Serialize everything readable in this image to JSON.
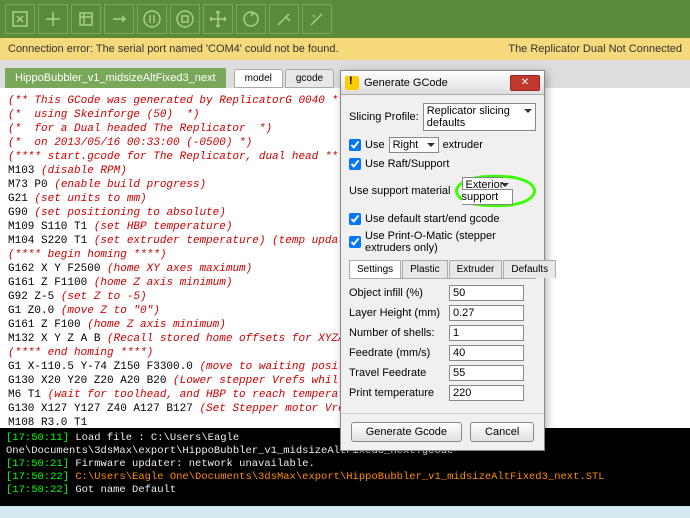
{
  "error": {
    "msg": "Connection error: The serial port named 'COM4' could not be found.",
    "right": "The Replicator Dual Not Connected"
  },
  "file": "HippoBubbler_v1_midsizeAltFixed3_next",
  "tabs": {
    "model": "model",
    "gcode": "gcode"
  },
  "code": {
    "l1": "(** This GCode was generated by ReplicatorG 0040 **",
    "l2": "(*  using Skeinforge (50)  *)",
    "l3": "(*  for a Dual headed The Replicator  *)",
    "l4": "(*  on 2013/05/16 00:33:00 (-0500) *)",
    "l5": "(**** start.gcode for The Replicator, dual head ****",
    "l6a": "M103",
    "l6b": "(disable RPM)",
    "l7a": "M73 P0",
    "l7b": "(enable build progress)",
    "l8a": "G21",
    "l8b": "(set units to mm)",
    "l9a": "G90",
    "l9b": "(set positioning to absolute)",
    "l10a": "M109 S110 T1",
    "l10b": "(set HBP temperature)",
    "l11a": "M104 S220 T1",
    "l11b": "(set extruder temperature) (temp updat",
    "l12": "(**** begin homing ****)",
    "l13a": "G162 X Y F2500",
    "l13b": "(home XY axes maximum)",
    "l14a": "G161 Z F1100",
    "l14b": "(home Z axis minimum)",
    "l15a": "G92 Z-5",
    "l15b": "(set Z to -5)",
    "l16a": "G1 Z0.0",
    "l16b": "(move Z to \"0\")",
    "l17a": "G161 Z F100",
    "l17b": "(home Z axis minimum)",
    "l18a": "M132 X Y Z A B",
    "l18b": "(Recall stored home offsets for XYZA",
    "l19": "(**** end homing ****)",
    "l20a": "G1 X-110.5 Y-74 Z150 F3300.0",
    "l20b": "(move to waiting posit",
    "l21a": "G130 X20 Y20 Z20 A20 B20",
    "l21b": "(Lower stepper Vrefs whil",
    "l22a": "M6 T1",
    "l22b": "(wait for toolhead, and HBP to reach temperat",
    "l23a": "G130 X127 Y127 Z40 A127 B127",
    "l23b": "(Set Stepper motor Vre",
    "l24a": "M108 R3.0 T1"
  },
  "console": {
    "l1t": "[17:50:11]",
    "l1x": " Load file : C:\\Users\\Eagle",
    "l2": "One\\Documents\\3dsMax\\export\\HippoBubbler_v1_midsizeAltFixed3_next.gcode",
    "l3t": "[17:50:21]",
    "l3x": " Firmware updater: network unavailable.",
    "l4t": "[17:50:22]",
    "l4x": " C:\\Users\\Eagle One\\Documents\\3dsMax\\export\\HippoBubbler_v1_midsizeAltFixed3_next.STL",
    "l5t": "[17:50:22]",
    "l5x": " Got name Default"
  },
  "dialog": {
    "title": "Generate GCode",
    "profile_label": "Slicing Profile:",
    "profile_value": "Replicator slicing defaults",
    "use_label": "Use",
    "extruder_side": "Right",
    "extruder_word": "extruder",
    "use_raft": "Use Raft/Support",
    "support_label": "Use support material",
    "support_value": "Exterior support",
    "use_default_se": "Use default start/end gcode",
    "use_pom": "Use Print-O-Matic (stepper extruders only)",
    "tabs": {
      "settings": "Settings",
      "plastic": "Plastic",
      "extruder": "Extruder",
      "defaults": "Defaults"
    },
    "params": {
      "infill_l": "Object infill (%)",
      "infill_v": "50",
      "layer_l": "Layer Height (mm)",
      "layer_v": "0.27",
      "shells_l": "Number of shells:",
      "shells_v": "1",
      "feed_l": "Feedrate (mm/s)",
      "feed_v": "40",
      "travel_l": "Travel Feedrate",
      "travel_v": "55",
      "temp_l": "Print temperature",
      "temp_v": "220"
    },
    "btn_generate": "Generate Gcode",
    "btn_cancel": "Cancel"
  }
}
